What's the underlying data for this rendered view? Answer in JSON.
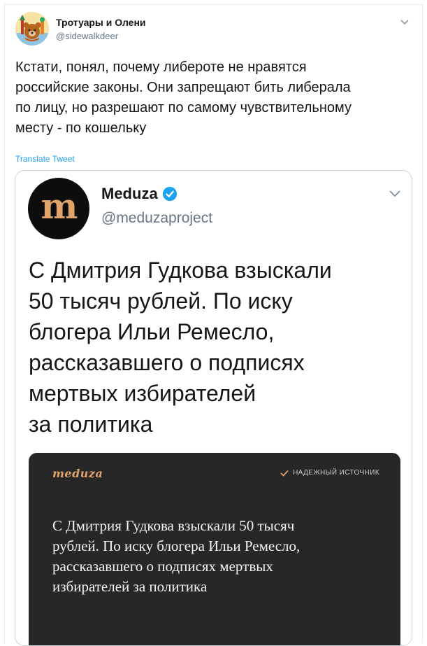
{
  "tweet": {
    "author_name": "Тротуары и Олени",
    "author_handle": "@sidewalkdeer",
    "text": "Кстати, понял, почему либероте не нравятся\nроссийские законы. Они запрещают бить либерала\nпо лицу, но разрешают по самому чувствительному\nместу - по кошельку",
    "translate_label": "Translate Tweet",
    "avatar_icon": "bear-kremlin-avatar-icon",
    "menu_icon": "chevron-down-icon"
  },
  "quoted": {
    "avatar_letter": "m",
    "author_name": "Meduza",
    "verified_icon": "verified-badge-icon",
    "author_handle": "@meduzaproject",
    "text": "С Дмитрия Гудкова взыскали\n50 тысяч рублей. По иску\nблогера Ильи Ремесло,\nрассказавшего о подписях\nмертвых избирателей\nза политика",
    "menu_icon": "chevron-down-icon",
    "media": {
      "logo": "meduza",
      "badge": "НАДЕЖНЫЙ ИСТОЧНИК",
      "badge_icon": "check-icon",
      "headline": "С Дмитрия Гудкова взыскали 50 тысяч\nрублей. По иску блогера Ильи Ремесло,\nрассказавшего о подписях мертвых\nизбирателей за политика"
    }
  },
  "colors": {
    "link": "#1da1f2",
    "secondary_text": "#657786",
    "verified": "#1da1f2",
    "meduza_gold": "#e0a46a",
    "dark_card_bg": "#272727"
  }
}
